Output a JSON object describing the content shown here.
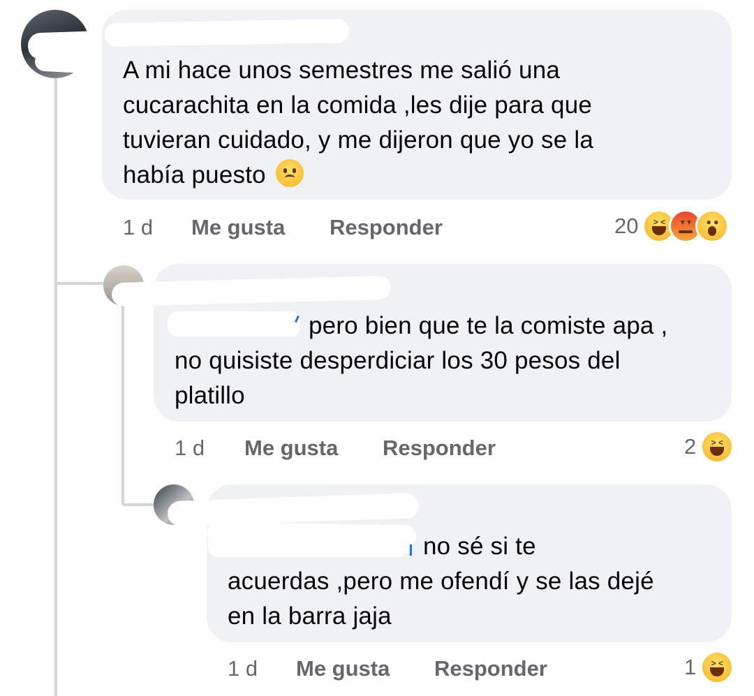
{
  "comments": [
    {
      "text_lines": [
        "A mi hace unos semestres me salió una",
        "cucarachita en la comida ,les dije para que",
        "tuvieran cuidado, y me dijeron que yo se la",
        "había puesto"
      ],
      "time": "1 d",
      "like_label": "Me gusta",
      "reply_label": "Responder",
      "reaction_count": "20",
      "reactions": [
        "laugh-emoji",
        "angry-emoji",
        "wow-emoji"
      ],
      "inline_emoji": "sad-face-emoji"
    },
    {
      "text_lines": [
        "pero bien que te la comiste apa ,",
        "no quisiste desperdiciar los 30 pesos del",
        "platillo"
      ],
      "time": "1 d",
      "like_label": "Me gusta",
      "reply_label": "Responder",
      "reaction_count": "2",
      "reactions": [
        "laugh-emoji"
      ]
    },
    {
      "text_lines": [
        "no sé si te",
        "acuerdas ,pero me ofendí y se las dejé",
        "en la barra jaja"
      ],
      "time": "1 d",
      "like_label": "Me gusta",
      "reply_label": "Responder",
      "reaction_count": "1",
      "reactions": [
        "laugh-emoji"
      ]
    }
  ],
  "colors": {
    "bubble": "#f0f1f4",
    "meta_text": "#65676b",
    "thread_line": "#d5d6da",
    "mention_blue": "#1b74e4"
  }
}
